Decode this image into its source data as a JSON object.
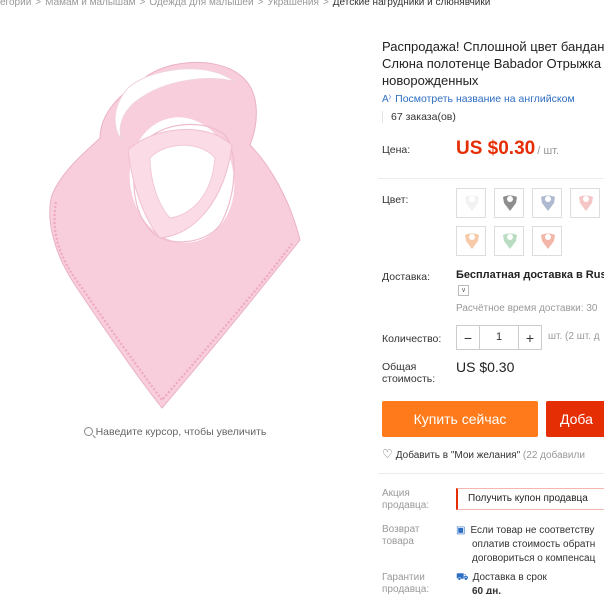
{
  "breadcrumb": [
    "егории",
    "Мамам и малышам",
    "Одежда для малышей",
    "Украшения",
    "Детские нагрудники и слюнявчики"
  ],
  "breadcrumb_sep": ">",
  "product": {
    "title_lines": [
      "Распродажа! Сплошной цвет бандан",
      "Слюна полотенце Babador Отрыжка",
      "новорожденных"
    ],
    "translate_link": "Посмотреть название на английском",
    "orders": "67 заказа(ов)"
  },
  "price": {
    "label": "Цена:",
    "value": "US $0.30",
    "unit": "/ шт."
  },
  "color": {
    "label": "Цвет:",
    "swatches": [
      "#f2f2f2",
      "#8e8e8e",
      "#aebad0",
      "#f5c6c6",
      "#f6c9a8",
      "#b9dcc3",
      "#f2b7a8"
    ]
  },
  "shipping": {
    "label": "Доставка:",
    "value": "Бесплатная доставка в Russi",
    "estimate": "Расчётное время доставки: 30"
  },
  "quantity": {
    "label": "Количество:",
    "minus": "−",
    "value": "1",
    "plus": "+",
    "available": "шт. (2 шт. д"
  },
  "total": {
    "label_1": "Общая",
    "label_2": "стоимость:",
    "value": "US $0.30"
  },
  "buttons": {
    "buy_now": "Купить сейчас",
    "add_to_cart": "Доба"
  },
  "wishlist": {
    "text": "Добавить в \"Мои желания\"",
    "count": "(22 добавили"
  },
  "promotion": {
    "label_1": "Акция",
    "label_2": "продавца:",
    "coupon": "Получить купон продавца"
  },
  "return": {
    "label_1": "Возврат",
    "label_2": "товара",
    "lines": [
      "Если товар не соответству",
      "оплатив стоимость обратн",
      "договориться о компенсац"
    ]
  },
  "guarantee": {
    "label_1": "Гарантии",
    "label_2": "продавца:",
    "lines": [
      "Доставка в срок",
      "60 дн."
    ]
  },
  "zoom_hint": "Наведите курсор, чтобы увеличить",
  "colors": {
    "price": "#e62e04",
    "buy": "#ff7a1a",
    "cart": "#e62e04",
    "link": "#2e6ec2",
    "bib": "#f7c9d8"
  },
  "icons": {
    "translate": "translate-icon",
    "heart": "heart-icon",
    "zoom": "magnifier-icon"
  }
}
